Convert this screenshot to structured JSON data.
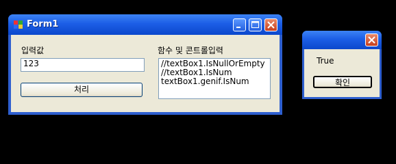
{
  "main_window": {
    "title": "Form1",
    "input_label": "입력값",
    "input_value": "123",
    "process_button": "처리",
    "function_label": "함수 및 콘트롤입력",
    "code_lines": [
      "//textBox1.IsNullOrEmpty",
      "//textBox1.IsNum",
      "textBox1.genif.IsNum"
    ]
  },
  "message_box": {
    "message": "True",
    "ok_button": "확인"
  }
}
